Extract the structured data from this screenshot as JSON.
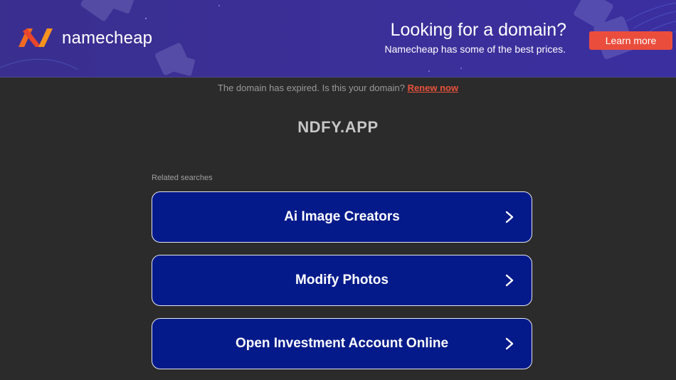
{
  "banner": {
    "brand": "namecheap",
    "promo_title": "Looking for a domain?",
    "promo_subtitle": "Namecheap has some of the best prices.",
    "learn_more": "Learn more",
    "accent_color": "#eb4d3d",
    "background_color": "#3b2f97"
  },
  "notice": {
    "text": "The domain has expired. Is this your domain?",
    "link": "Renew now"
  },
  "domain": "NDFY.APP",
  "related": {
    "label": "Related searches",
    "items": [
      {
        "label": "Ai Image Creators"
      },
      {
        "label": "Modify Photos"
      },
      {
        "label": "Open Investment Account Online"
      }
    ]
  }
}
